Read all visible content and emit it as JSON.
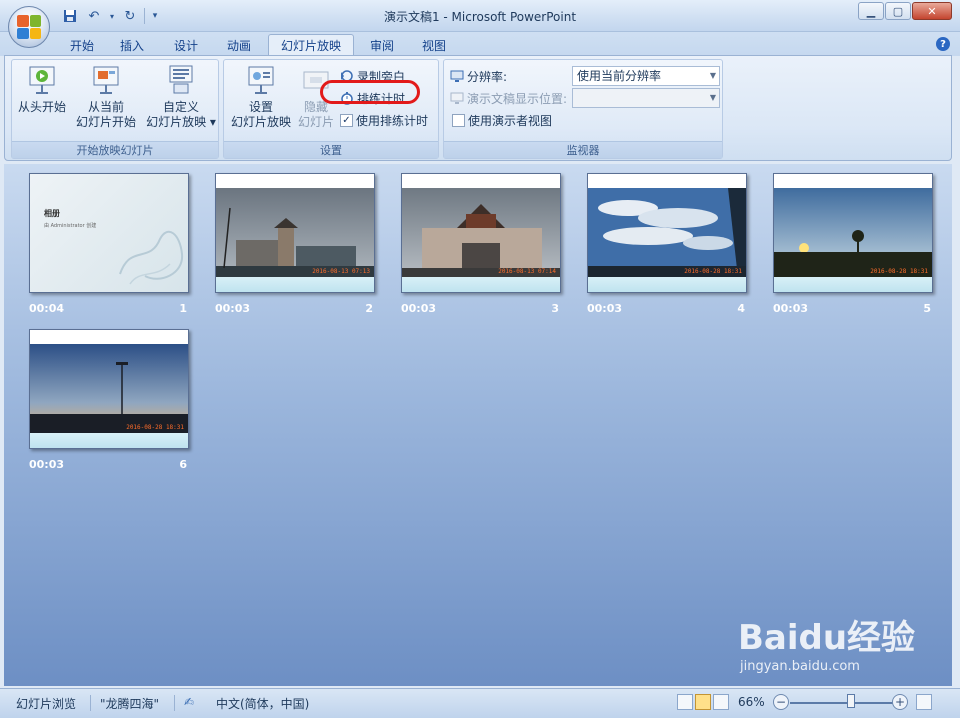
{
  "window": {
    "title": "演示文稿1 - Microsoft PowerPoint"
  },
  "tabs": [
    {
      "label": "开始"
    },
    {
      "label": "插入"
    },
    {
      "label": "设计"
    },
    {
      "label": "动画"
    },
    {
      "label": "幻灯片放映",
      "active": true
    },
    {
      "label": "审阅"
    },
    {
      "label": "视图"
    }
  ],
  "ribbon": {
    "group_start": {
      "label": "开始放映幻灯片",
      "from_beginning": "从头开始",
      "from_current_line1": "从当前",
      "from_current_line2": "幻灯片开始",
      "custom_line1": "自定义",
      "custom_line2": "幻灯片放映"
    },
    "group_setup": {
      "label": "设置",
      "setup_line1": "设置",
      "setup_line2": "幻灯片放映",
      "hide_line1": "隐藏",
      "hide_line2": "幻灯片",
      "record_narration": "录制旁白",
      "rehearse_timings": "排练计时",
      "use_timings": "使用排练计时",
      "use_timings_checked": true
    },
    "group_monitors": {
      "label": "监视器",
      "resolution_label": "分辨率:",
      "resolution_value": "使用当前分辨率",
      "show_on_label": "演示文稿显示位置:",
      "show_on_value": "",
      "presenter_view": "使用演示者视图",
      "presenter_view_checked": false
    }
  },
  "slides": [
    {
      "number": "1",
      "time": "00:04",
      "title": "相册",
      "subtitle": "由 Administrator 创建",
      "stamp": ""
    },
    {
      "number": "2",
      "time": "00:03",
      "stamp": "2016-08-13 07:13"
    },
    {
      "number": "3",
      "time": "00:03",
      "stamp": "2016-08-13 07:14"
    },
    {
      "number": "4",
      "time": "00:03",
      "stamp": "2016-08-28 18:31"
    },
    {
      "number": "5",
      "time": "00:03",
      "stamp": "2016-08-28 18:31"
    },
    {
      "number": "6",
      "time": "00:03",
      "stamp": "2016-08-28 18:31"
    }
  ],
  "statusbar": {
    "view": "幻灯片浏览",
    "theme": "\"龙腾四海\"",
    "language": "中文(简体，中国)",
    "zoom": "66%"
  },
  "watermark": {
    "brand": "Baidu经验",
    "url": "jingyan.baidu.com"
  }
}
